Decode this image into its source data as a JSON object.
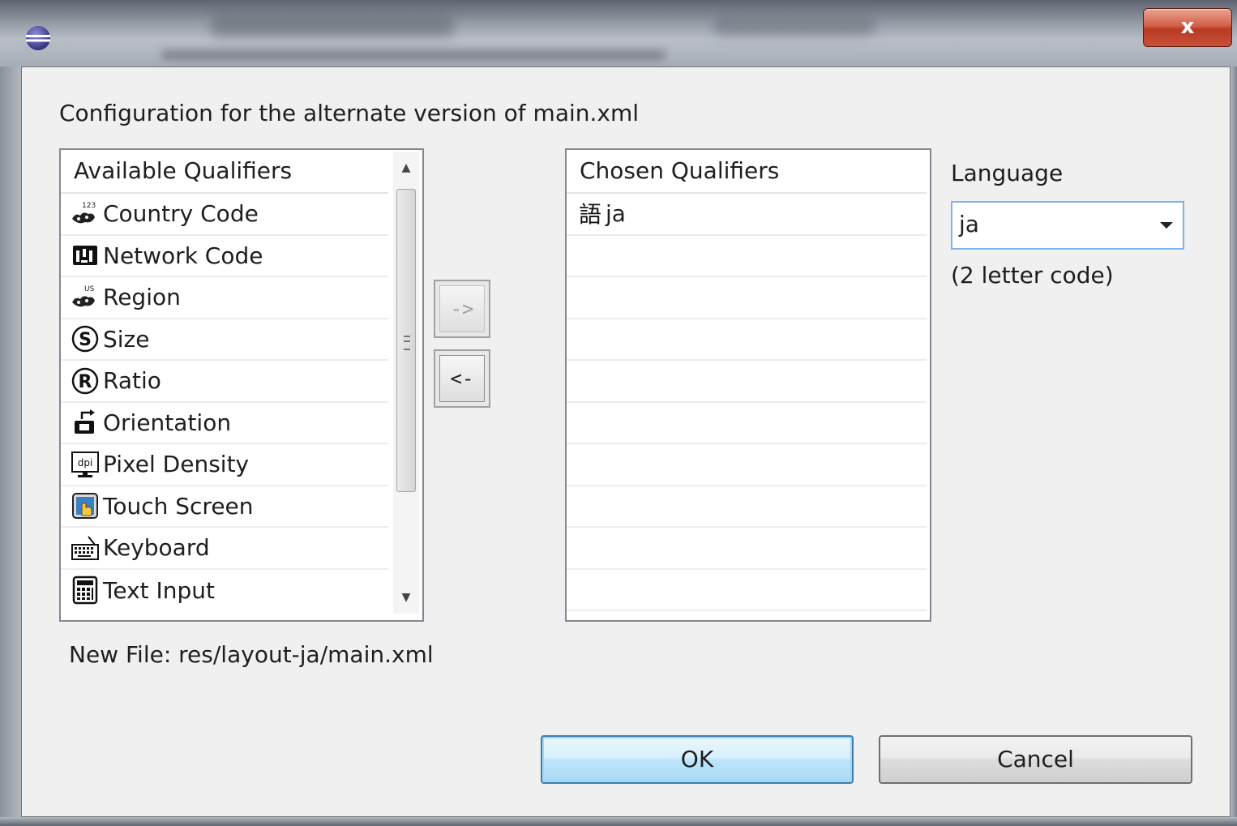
{
  "window": {
    "close_glyph": "x",
    "app_icon": "eclipse-icon"
  },
  "dialog": {
    "heading": "Configuration for the alternate version of main.xml",
    "available": {
      "header": "Available Qualifiers",
      "items": [
        {
          "label": "Country Code",
          "icon": "country-code-icon"
        },
        {
          "label": "Network Code",
          "icon": "network-code-icon"
        },
        {
          "label": "Region",
          "icon": "region-icon"
        },
        {
          "label": "Size",
          "icon": "size-icon"
        },
        {
          "label": "Ratio",
          "icon": "ratio-icon"
        },
        {
          "label": "Orientation",
          "icon": "orientation-icon"
        },
        {
          "label": "Pixel Density",
          "icon": "pixel-density-icon"
        },
        {
          "label": "Touch Screen",
          "icon": "touch-screen-icon"
        },
        {
          "label": "Keyboard",
          "icon": "keyboard-icon"
        },
        {
          "label": "Text Input",
          "icon": "text-input-icon"
        }
      ]
    },
    "add_button": "->",
    "remove_button": "<-",
    "chosen": {
      "header": "Chosen Qualifiers",
      "items": [
        {
          "label": "ja",
          "icon": "language-icon"
        }
      ]
    },
    "language": {
      "label": "Language",
      "value": "ja",
      "hint": "(2 letter code)"
    },
    "new_file": "New File: res/layout-ja/main.xml",
    "ok_button": "OK",
    "cancel_button": "Cancel"
  }
}
